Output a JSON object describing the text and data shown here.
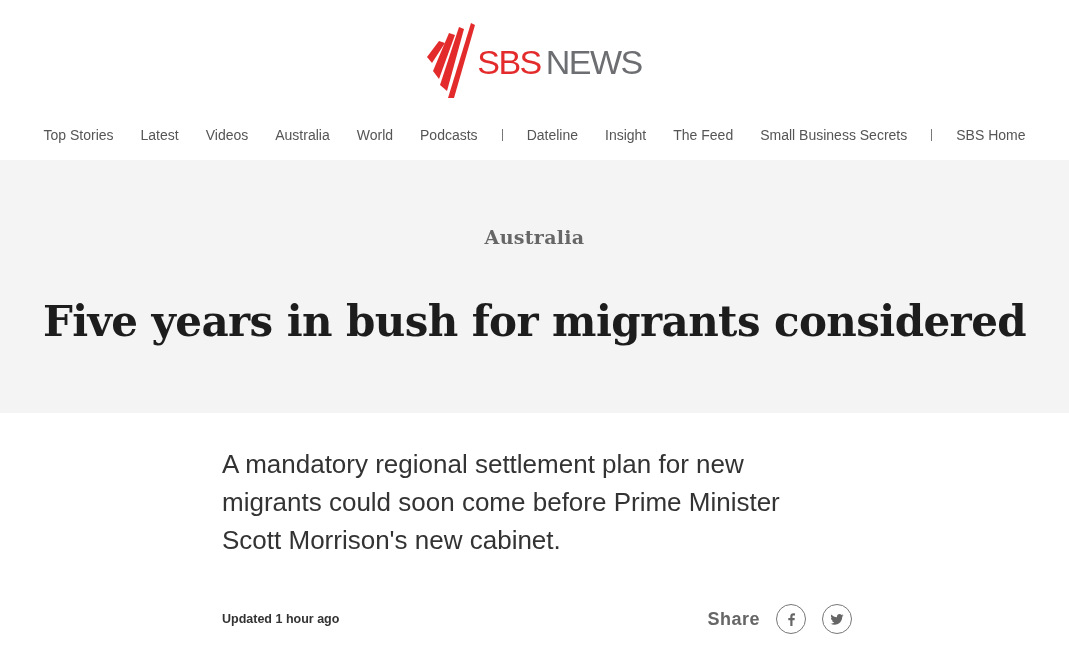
{
  "logo": {
    "brand": "SBS",
    "section": "NEWS"
  },
  "nav": [
    {
      "items": [
        "Top Stories",
        "Latest",
        "Videos",
        "Australia",
        "World",
        "Podcasts"
      ]
    },
    {
      "items": [
        "Dateline",
        "Insight",
        "The Feed",
        "Small Business Secrets"
      ]
    },
    {
      "items": [
        "SBS Home"
      ]
    }
  ],
  "hero": {
    "category": "Australia",
    "headline": "Five years in bush for migrants considered"
  },
  "article": {
    "lead": "A mandatory regional settlement plan for new migrants could soon come before Prime Minister Scott Morrison's new cabinet.",
    "updated": "Updated 1 hour ago",
    "share": {
      "label": "Share",
      "buttons": [
        {
          "kind": "facebook"
        },
        {
          "kind": "twitter"
        }
      ]
    }
  }
}
